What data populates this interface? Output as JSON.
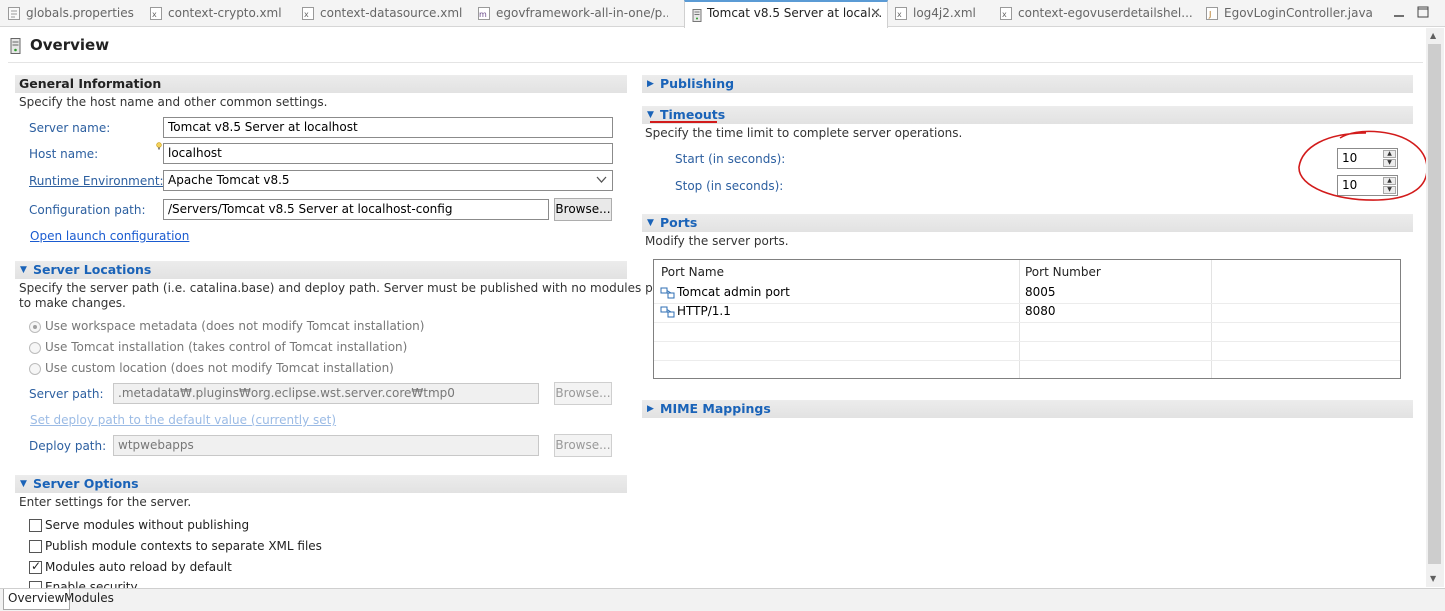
{
  "tabs": [
    {
      "label": "globals.properties",
      "icon": "properties-file-icon"
    },
    {
      "label": "context-crypto.xml",
      "icon": "xml-file-icon"
    },
    {
      "label": "context-datasource.xml",
      "icon": "xml-file-icon"
    },
    {
      "label": "egovframework-all-in-one/p...",
      "icon": "maven-pom-icon"
    },
    {
      "label": "Tomcat v8.5 Server at local...",
      "icon": "server-icon",
      "active": true
    },
    {
      "label": "log4j2.xml",
      "icon": "xml-file-icon"
    },
    {
      "label": "context-egovuserdetailshel...",
      "icon": "xml-file-icon"
    },
    {
      "label": "EgovLoginController.java",
      "icon": "java-file-icon"
    }
  ],
  "close_glyph": "✕",
  "form_title": "Overview",
  "general": {
    "title": "General Information",
    "desc": "Specify the host name and other common settings.",
    "server_name_label": "Server name:",
    "server_name_value": "Tomcat v8.5 Server at localhost",
    "host_name_label": "Host name:",
    "host_name_value": "localhost",
    "runtime_label": "Runtime Environment:",
    "runtime_value": "Apache Tomcat v8.5",
    "config_label": "Configuration path:",
    "config_value": "/Servers/Tomcat v8.5 Server at localhost-config",
    "browse": "Browse...",
    "open_launch": "Open launch configuration"
  },
  "locations": {
    "title": "Server Locations",
    "desc_line1": "Specify the server path (i.e. catalina.base) and deploy path. Server must be published with no modules present",
    "desc_line2": "to make changes.",
    "opt1": "Use workspace metadata (does not modify Tomcat installation)",
    "opt2": "Use Tomcat installation (takes control of Tomcat installation)",
    "opt3": "Use custom location (does not modify Tomcat installation)",
    "server_path_label": "Server path:",
    "server_path_value": ".metadata₩.plugins₩org.eclipse.wst.server.core₩tmp0",
    "browse": "Browse...",
    "set_deploy": "Set deploy path to the default value (currently set)",
    "deploy_label": "Deploy path:",
    "deploy_value": "wtpwebapps",
    "browse2": "Browse..."
  },
  "options": {
    "title": "Server Options",
    "desc": "Enter settings for the server.",
    "items": [
      {
        "label": "Serve modules without publishing",
        "checked": false
      },
      {
        "label": "Publish module contexts to separate XML files",
        "checked": false
      },
      {
        "label": "Modules auto reload by default",
        "checked": true
      },
      {
        "label": "Enable security",
        "checked": false
      }
    ],
    "check_glyph": "✓"
  },
  "publishing": {
    "title": "Publishing"
  },
  "timeouts": {
    "title": "Timeouts",
    "desc": "Specify the time limit to complete server operations.",
    "start_label": "Start (in seconds):",
    "start_value": "10",
    "stop_label": "Stop (in seconds):",
    "stop_value": "10"
  },
  "ports": {
    "title": "Ports",
    "desc": "Modify the server ports.",
    "col_name": "Port Name",
    "col_number": "Port Number",
    "rows": [
      {
        "name": "Tomcat admin port",
        "number": "8005"
      },
      {
        "name": "HTTP/1.1",
        "number": "8080"
      }
    ]
  },
  "mime": {
    "title": "MIME Mappings"
  },
  "bottom_tabs": [
    "Overview",
    "Modules"
  ],
  "colors": {
    "accent": "#1a63b8",
    "annotation": "#d21b1b",
    "link": "#1a5bd0"
  }
}
